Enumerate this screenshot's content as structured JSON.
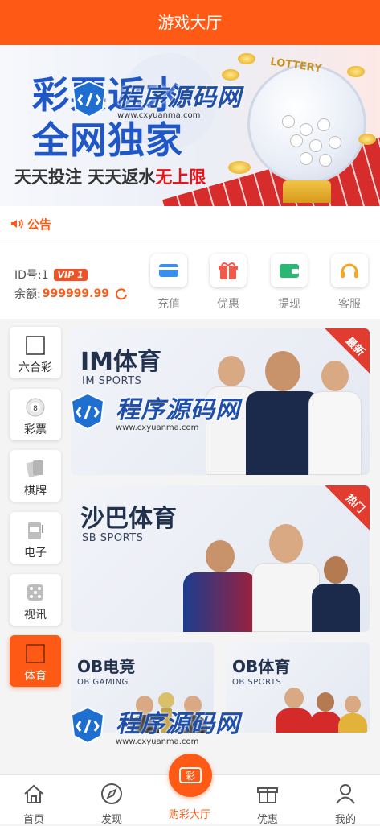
{
  "header": {
    "title": "游戏大厅"
  },
  "banner": {
    "title_line1": "彩票返水",
    "title_line2": "全网独家",
    "subtitle_black": "天天投注 天天返水",
    "subtitle_red": "无上限",
    "tag": "LOTTERY"
  },
  "notice": {
    "label": "公告"
  },
  "account": {
    "id_label": "ID号:1",
    "vip_label": "VIP 1",
    "balance_label": "余额:",
    "balance_value": "999999.99"
  },
  "quick_actions": [
    {
      "label": "充值",
      "icon": "card-icon",
      "color": "#3a8ef0"
    },
    {
      "label": "优惠",
      "icon": "gift-icon",
      "color": "#f05a4a"
    },
    {
      "label": "提现",
      "icon": "wallet-icon",
      "color": "#2bb673"
    },
    {
      "label": "客服",
      "icon": "headset-icon",
      "color": "#f5a623"
    }
  ],
  "side_nav": [
    {
      "label": "六合彩",
      "icon": "square-icon"
    },
    {
      "label": "彩票",
      "icon": "lottery-ball-icon"
    },
    {
      "label": "棋牌",
      "icon": "cards-icon"
    },
    {
      "label": "电子",
      "icon": "slot-machine-icon"
    },
    {
      "label": "视讯",
      "icon": "dice-icon"
    },
    {
      "label": "体育",
      "icon": "square-icon",
      "active": true
    }
  ],
  "games": [
    {
      "title": "IM体育",
      "subtitle": "IM SPORTS",
      "ribbon": "最新"
    },
    {
      "title": "沙巴体育",
      "subtitle": "SB SPORTS",
      "ribbon": "热门"
    },
    {
      "title": "OB电竞",
      "subtitle": "OB GAMING"
    },
    {
      "title": "OB体育",
      "subtitle": "OB SPORTS"
    }
  ],
  "watermark": {
    "text": "程序源码网",
    "url": "www.cxyuanma.com"
  },
  "tabbar": [
    {
      "label": "首页",
      "icon": "home-icon"
    },
    {
      "label": "发现",
      "icon": "compass-icon"
    },
    {
      "label": "购彩大厅",
      "icon": "lottery-icon",
      "active": true,
      "center_glyph": "彩"
    },
    {
      "label": "优惠",
      "icon": "gift-icon"
    },
    {
      "label": "我的",
      "icon": "user-icon"
    }
  ],
  "colors": {
    "brand": "#fe5a16",
    "vip": "#f05225",
    "banner_blue": "#1f56c8"
  }
}
